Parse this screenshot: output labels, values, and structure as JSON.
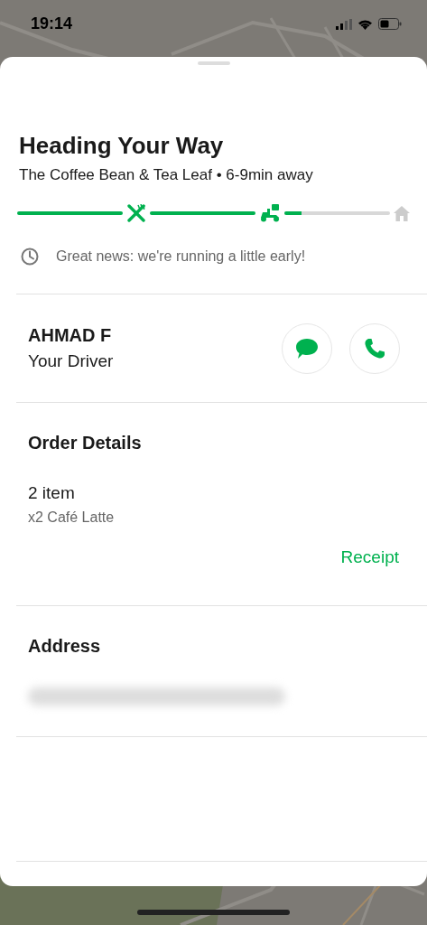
{
  "status_bar": {
    "time": "19:14"
  },
  "header": {
    "title": "Heading Your Way",
    "subtitle": "The Coffee Bean & Tea Leaf • 6-9min away"
  },
  "progress": {
    "stops": [
      {
        "kind": "restaurant",
        "reached": true
      },
      {
        "kind": "scooter",
        "reached": true
      },
      {
        "kind": "home",
        "reached": false
      }
    ],
    "segments": [
      {
        "level": 1
      },
      {
        "level": 1
      },
      {
        "level": 0.16
      }
    ]
  },
  "notice": "Great news: we're running a little early!",
  "driver": {
    "name": "AHMAD F",
    "role": "Your Driver"
  },
  "order": {
    "heading": "Order Details",
    "count": "2 item",
    "items": [
      "x2 Café Latte"
    ],
    "receipt": "Receipt"
  },
  "address": {
    "heading": "Address",
    "redacted": true
  }
}
